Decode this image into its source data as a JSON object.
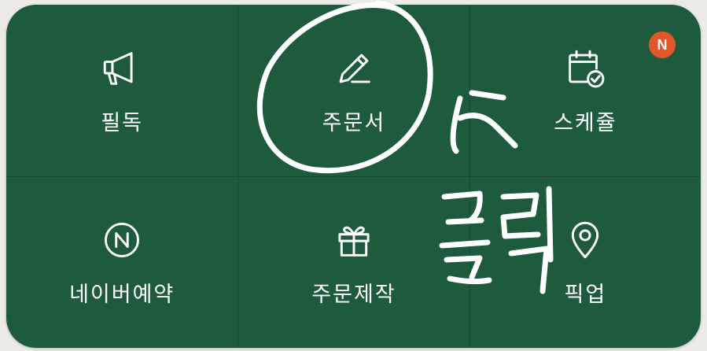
{
  "menu": {
    "items": [
      {
        "label": "필독",
        "icon": "megaphone-icon"
      },
      {
        "label": "주문서",
        "icon": "pencil-icon"
      },
      {
        "label": "스케쥴",
        "icon": "calendar-check-icon"
      },
      {
        "label": "네이버예약",
        "icon": "naver-n-icon"
      },
      {
        "label": "주문제작",
        "icon": "gift-icon"
      },
      {
        "label": "픽업",
        "icon": "location-pin-icon"
      }
    ],
    "badge": "N"
  },
  "annotation": {
    "text": "클릭",
    "color": "#ffffff"
  },
  "colors": {
    "panel": "#1e5a3c",
    "badge": "#e2572a"
  }
}
